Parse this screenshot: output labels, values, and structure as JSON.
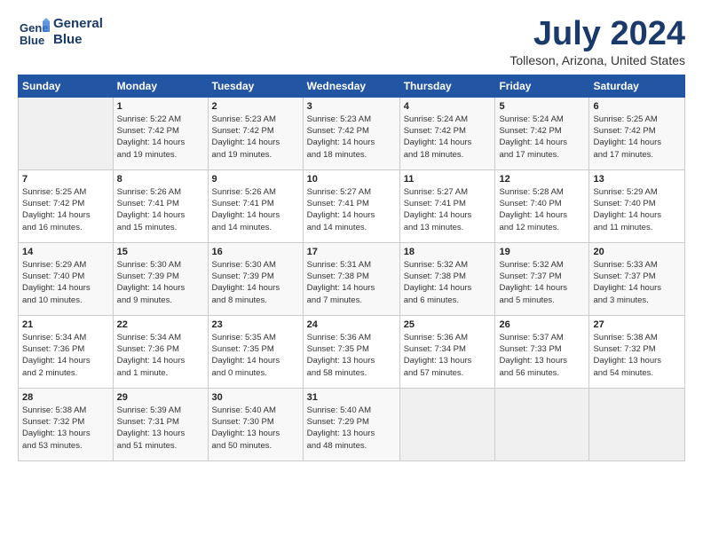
{
  "logo": {
    "line1": "General",
    "line2": "Blue"
  },
  "title": "July 2024",
  "location": "Tolleson, Arizona, United States",
  "days_of_week": [
    "Sunday",
    "Monday",
    "Tuesday",
    "Wednesday",
    "Thursday",
    "Friday",
    "Saturday"
  ],
  "weeks": [
    [
      {
        "day": "",
        "detail": ""
      },
      {
        "day": "1",
        "detail": "Sunrise: 5:22 AM\nSunset: 7:42 PM\nDaylight: 14 hours\nand 19 minutes."
      },
      {
        "day": "2",
        "detail": "Sunrise: 5:23 AM\nSunset: 7:42 PM\nDaylight: 14 hours\nand 19 minutes."
      },
      {
        "day": "3",
        "detail": "Sunrise: 5:23 AM\nSunset: 7:42 PM\nDaylight: 14 hours\nand 18 minutes."
      },
      {
        "day": "4",
        "detail": "Sunrise: 5:24 AM\nSunset: 7:42 PM\nDaylight: 14 hours\nand 18 minutes."
      },
      {
        "day": "5",
        "detail": "Sunrise: 5:24 AM\nSunset: 7:42 PM\nDaylight: 14 hours\nand 17 minutes."
      },
      {
        "day": "6",
        "detail": "Sunrise: 5:25 AM\nSunset: 7:42 PM\nDaylight: 14 hours\nand 17 minutes."
      }
    ],
    [
      {
        "day": "7",
        "detail": "Sunrise: 5:25 AM\nSunset: 7:42 PM\nDaylight: 14 hours\nand 16 minutes."
      },
      {
        "day": "8",
        "detail": "Sunrise: 5:26 AM\nSunset: 7:41 PM\nDaylight: 14 hours\nand 15 minutes."
      },
      {
        "day": "9",
        "detail": "Sunrise: 5:26 AM\nSunset: 7:41 PM\nDaylight: 14 hours\nand 14 minutes."
      },
      {
        "day": "10",
        "detail": "Sunrise: 5:27 AM\nSunset: 7:41 PM\nDaylight: 14 hours\nand 14 minutes."
      },
      {
        "day": "11",
        "detail": "Sunrise: 5:27 AM\nSunset: 7:41 PM\nDaylight: 14 hours\nand 13 minutes."
      },
      {
        "day": "12",
        "detail": "Sunrise: 5:28 AM\nSunset: 7:40 PM\nDaylight: 14 hours\nand 12 minutes."
      },
      {
        "day": "13",
        "detail": "Sunrise: 5:29 AM\nSunset: 7:40 PM\nDaylight: 14 hours\nand 11 minutes."
      }
    ],
    [
      {
        "day": "14",
        "detail": "Sunrise: 5:29 AM\nSunset: 7:40 PM\nDaylight: 14 hours\nand 10 minutes."
      },
      {
        "day": "15",
        "detail": "Sunrise: 5:30 AM\nSunset: 7:39 PM\nDaylight: 14 hours\nand 9 minutes."
      },
      {
        "day": "16",
        "detail": "Sunrise: 5:30 AM\nSunset: 7:39 PM\nDaylight: 14 hours\nand 8 minutes."
      },
      {
        "day": "17",
        "detail": "Sunrise: 5:31 AM\nSunset: 7:38 PM\nDaylight: 14 hours\nand 7 minutes."
      },
      {
        "day": "18",
        "detail": "Sunrise: 5:32 AM\nSunset: 7:38 PM\nDaylight: 14 hours\nand 6 minutes."
      },
      {
        "day": "19",
        "detail": "Sunrise: 5:32 AM\nSunset: 7:37 PM\nDaylight: 14 hours\nand 5 minutes."
      },
      {
        "day": "20",
        "detail": "Sunrise: 5:33 AM\nSunset: 7:37 PM\nDaylight: 14 hours\nand 3 minutes."
      }
    ],
    [
      {
        "day": "21",
        "detail": "Sunrise: 5:34 AM\nSunset: 7:36 PM\nDaylight: 14 hours\nand 2 minutes."
      },
      {
        "day": "22",
        "detail": "Sunrise: 5:34 AM\nSunset: 7:36 PM\nDaylight: 14 hours\nand 1 minute."
      },
      {
        "day": "23",
        "detail": "Sunrise: 5:35 AM\nSunset: 7:35 PM\nDaylight: 14 hours\nand 0 minutes."
      },
      {
        "day": "24",
        "detail": "Sunrise: 5:36 AM\nSunset: 7:35 PM\nDaylight: 13 hours\nand 58 minutes."
      },
      {
        "day": "25",
        "detail": "Sunrise: 5:36 AM\nSunset: 7:34 PM\nDaylight: 13 hours\nand 57 minutes."
      },
      {
        "day": "26",
        "detail": "Sunrise: 5:37 AM\nSunset: 7:33 PM\nDaylight: 13 hours\nand 56 minutes."
      },
      {
        "day": "27",
        "detail": "Sunrise: 5:38 AM\nSunset: 7:32 PM\nDaylight: 13 hours\nand 54 minutes."
      }
    ],
    [
      {
        "day": "28",
        "detail": "Sunrise: 5:38 AM\nSunset: 7:32 PM\nDaylight: 13 hours\nand 53 minutes."
      },
      {
        "day": "29",
        "detail": "Sunrise: 5:39 AM\nSunset: 7:31 PM\nDaylight: 13 hours\nand 51 minutes."
      },
      {
        "day": "30",
        "detail": "Sunrise: 5:40 AM\nSunset: 7:30 PM\nDaylight: 13 hours\nand 50 minutes."
      },
      {
        "day": "31",
        "detail": "Sunrise: 5:40 AM\nSunset: 7:29 PM\nDaylight: 13 hours\nand 48 minutes."
      },
      {
        "day": "",
        "detail": ""
      },
      {
        "day": "",
        "detail": ""
      },
      {
        "day": "",
        "detail": ""
      }
    ]
  ]
}
